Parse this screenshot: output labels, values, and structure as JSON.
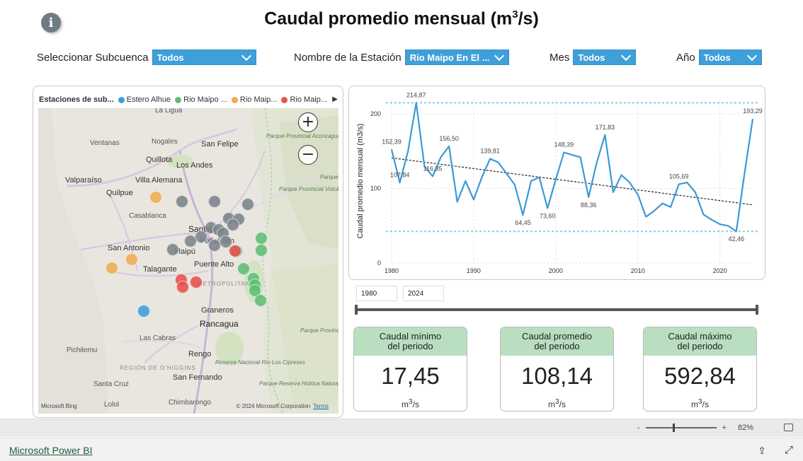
{
  "report": {
    "title_main": "Caudal promedio mensual (m",
    "title_sup": "3",
    "title_end": "/s)"
  },
  "filters": [
    {
      "label": "Seleccionar Subcuenca",
      "value": "Todos"
    },
    {
      "label": "Nombre de la Estación",
      "value": "Rio Maipo En El ..."
    },
    {
      "label": "Mes",
      "value": "Todos"
    },
    {
      "label": "Año",
      "value": "Todos"
    }
  ],
  "map": {
    "legend_title": "Estaciones de sub...",
    "legend_items": [
      {
        "label": "Estero Alhue",
        "color": "#3f9ed9"
      },
      {
        "label": "Rio Maipo ...",
        "color": "#5fbf74"
      },
      {
        "label": "Rio Maip...",
        "color": "#f0ac55"
      },
      {
        "label": "Rio Maip...",
        "color": "#e8524b"
      }
    ],
    "other_color": "#7c858b",
    "zoom_in": "+",
    "zoom_out": "−",
    "attribution": "Microsoft Bing",
    "copyright": "© 2024 Microsoft Corporation",
    "terms": "Terms",
    "labels": {
      "la_ligua": "La Ligua",
      "nogales": "Nogales",
      "ventanas": "Ventanas",
      "san_felipe": "San Felipe",
      "quillota": "Quillota",
      "los_andes": "Los Andes",
      "valparaiso": "Valparaíso",
      "villa_alemana": "Villa Alemana",
      "quilpue": "Quilpue",
      "casablanca": "Casablanca",
      "santiago": "Santiago",
      "penalolen": "Peñalolén",
      "maipu": "Maipú",
      "san_antonio": "San Antonio",
      "puente_alto": "Puente Alto",
      "talagante": "Talagante",
      "graneros": "Graneros",
      "rancagua": "Rancagua",
      "las_cabras": "Las Cabras",
      "pichilemu": "Pichilemu",
      "rengo": "Rengo",
      "region_ohiggins": "REGIÓN DE O'HIGGINS",
      "san_fernando": "San Fernando",
      "santa_cruz": "Santa Cruz",
      "lolol": "Lolol",
      "chimbarongo": "Chimbarongo",
      "metro": "METROPOLITANA",
      "park_aconcagua": "Parque Provincial Aconcagua",
      "park_tupungato": "Parque Provincial Volcán Tupungato",
      "park_cordon": "Parque Provincial Cordón",
      "park_diamante": "Parque Provincial Laguna del Diamante",
      "reserva_cipreses": "Reserva Nacional Río Los Cipreses",
      "reserva_hidrica": "Parque Reserva Hídrica Natural Los Reyunos"
    }
  },
  "chart_data": {
    "type": "line",
    "ylabel": "Caudal promedio mensual (m3/s)",
    "xlim": [
      1980,
      2024
    ],
    "ylim": [
      0,
      220
    ],
    "xticks": [
      1980,
      1990,
      2000,
      2010,
      2020
    ],
    "yticks": [
      0,
      100,
      200
    ],
    "x": [
      1980,
      1981,
      1982,
      1983,
      1984,
      1985,
      1986,
      1987,
      1988,
      1989,
      1990,
      1991,
      1992,
      1993,
      1994,
      1995,
      1996,
      1997,
      1998,
      1999,
      2000,
      2001,
      2002,
      2003,
      2004,
      2005,
      2006,
      2007,
      2008,
      2009,
      2010,
      2011,
      2012,
      2013,
      2014,
      2015,
      2016,
      2017,
      2018,
      2019,
      2020,
      2021,
      2022,
      2023,
      2024
    ],
    "y": [
      152.39,
      107.84,
      150,
      214.87,
      130,
      116.35,
      142,
      156.5,
      82,
      110,
      85,
      115,
      139.81,
      135,
      120,
      105,
      64.45,
      110,
      115,
      73.6,
      112,
      148.39,
      145,
      142,
      88.36,
      135,
      171.83,
      95,
      118,
      108,
      92,
      62,
      70,
      80,
      75,
      105.69,
      108,
      95,
      65,
      58,
      52,
      50,
      42.46,
      120,
      193.29
    ],
    "data_labels": [
      {
        "x": 1980,
        "y": 152.39,
        "text": "152,39"
      },
      {
        "x": 1981,
        "y": 107.84,
        "text": "107,84"
      },
      {
        "x": 1983,
        "y": 214.87,
        "text": "214,87"
      },
      {
        "x": 1985,
        "y": 116.35,
        "text": "116,35"
      },
      {
        "x": 1987,
        "y": 156.5,
        "text": "156,50"
      },
      {
        "x": 1992,
        "y": 139.81,
        "text": "139,81"
      },
      {
        "x": 1996,
        "y": 64.45,
        "text": "64,45"
      },
      {
        "x": 1999,
        "y": 73.6,
        "text": "73,60"
      },
      {
        "x": 2001,
        "y": 148.39,
        "text": "148,39"
      },
      {
        "x": 2004,
        "y": 88.36,
        "text": "88,36"
      },
      {
        "x": 2006,
        "y": 171.83,
        "text": "171,83"
      },
      {
        "x": 2015,
        "y": 105.69,
        "text": "105,69"
      },
      {
        "x": 2022,
        "y": 42.46,
        "text": "42,46"
      },
      {
        "x": 2024,
        "y": 193.29,
        "text": "193,29"
      }
    ],
    "reference_lines": [
      214.87,
      42.46
    ],
    "trend": {
      "y_start": 141,
      "y_end": 78
    },
    "line_color": "#3a9ad6",
    "ref_color": "#8ecae6",
    "grid": true
  },
  "year_range": {
    "from": "1980",
    "to": "2024"
  },
  "kpis": [
    {
      "title1": "Caudal mínimo",
      "title2": "del periodo",
      "value": "17,45",
      "unit_main": "m",
      "unit_sup": "3",
      "unit_end": "/s"
    },
    {
      "title1": "Caudal promedio",
      "title2": "del periodo",
      "value": "108,14",
      "unit_main": "m",
      "unit_sup": "3",
      "unit_end": "/s"
    },
    {
      "title1": "Caudal máximo",
      "title2": "del periodo",
      "value": "592,84",
      "unit_main": "m",
      "unit_sup": "3",
      "unit_end": "/s"
    }
  ],
  "statusbar": {
    "zoom_minus": "-",
    "zoom_plus": "+",
    "zoom_level": "82%"
  },
  "footer": {
    "brand": "Microsoft Power BI",
    "share_icon": "share-icon",
    "expand_icon": "expand-icon"
  }
}
